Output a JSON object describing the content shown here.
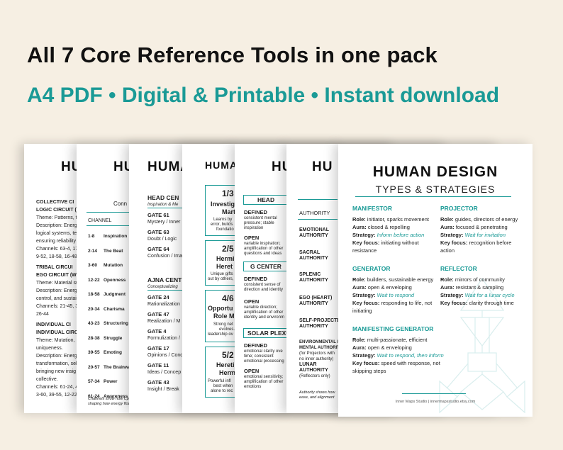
{
  "headline": "All 7 Core Reference Tools in one pack",
  "subline": "A4 PDF • Digital & Printable • Instant download",
  "colors": {
    "background": "#f6efe3",
    "teal": "#1a9a96",
    "text": "#111111"
  },
  "page1": {
    "title": "HU",
    "l1": "COLLECTIVE CI",
    "l2": "LOGIC CIRCUIT (L",
    "l3": "Theme: Patterns, t",
    "l4": "Description: Energ",
    "l5": "logical systems, te",
    "l6": "ensuring reliability",
    "l7": "Channels: 63-4, 17",
    "l8": "9-52, 18-58, 16-48",
    "l9": "TRIBAL CIRCUI",
    "l10": "EGO CIRCUIT (WI",
    "l11": "Theme: Material su",
    "l12": "Description: Energ",
    "l13": "control, and sustai",
    "l14": "Channels: 21-45, 3",
    "l15": "26-44",
    "l16": "INDIVIDUAL CI",
    "l17": "INDIVIDUAL CIRC",
    "l18": "Theme: Mutation,",
    "l19": "uniqueness.",
    "l20": "Description: Energ",
    "l21": "transformation, sel",
    "l22": "bringing new insig",
    "l23": "collective.",
    "l24": "Channels: 61-24, 4",
    "l25": "3-60, 39-55, 12-22,"
  },
  "page2": {
    "title": "HU",
    "conn": "Conn",
    "col": "CHANNEL",
    "rows": [
      {
        "num": "1-8",
        "name": "Inspiration"
      },
      {
        "num": "2-14",
        "name": "The Beat"
      },
      {
        "num": "3-60",
        "name": "Mutation"
      },
      {
        "num": "12-22",
        "name": "Openness"
      },
      {
        "num": "18-58",
        "name": "Judgment"
      },
      {
        "num": "20-34",
        "name": "Charisma"
      },
      {
        "num": "43-23",
        "name": "Structuring"
      },
      {
        "num": "28-38",
        "name": "Struggle"
      },
      {
        "num": "39-55",
        "name": "Emoting"
      },
      {
        "num": "20-57",
        "name": "The Brainwa"
      },
      {
        "num": "57-34",
        "name": "Power"
      },
      {
        "num": "61-24",
        "name": "Awareness"
      }
    ],
    "foot1": "Channels show how Cp",
    "foot2": "shaping how energy flow"
  },
  "page3": {
    "title": "HUMAN",
    "head": "HEAD CEN",
    "head_sub": "Inspiration & Me",
    "g61": "GATE 61",
    "g61d": "Mystery / Inner",
    "g63": "GATE 63",
    "g63d": "Doubt / Logic",
    "g64": "GATE 64",
    "g64d": "Confusion / Ima",
    "ajna": "AJNA CENT",
    "ajna_sub": "Conceptualizing",
    "g24": "GATE 24",
    "g24d": "Rationalization",
    "g47": "GATE 47",
    "g47d": "Realization / M",
    "g4": "GATE 4",
    "g4d": "Formulization /",
    "g17": "GATE 17",
    "g17d": "Opinions / Cond",
    "g11": "GATE 11",
    "g11d": "Ideas / Concep",
    "g43": "GATE 43",
    "g43d": "Insight / Break"
  },
  "page4": {
    "title": "HUMA",
    "c1a": "1/3",
    "c1b": "Investig",
    "c1c": "Mart",
    "c1d": "Learns by",
    "c1e": "error, builds",
    "c1f": "foundatio",
    "c2a": "2/5",
    "c2b": "Hermi",
    "c2c": "Heret",
    "c2d": "Unique gifts",
    "c2e": "out by others,",
    "c2f": "problem-s",
    "c3a": "4/6",
    "c3b": "Opportu",
    "c3c": "Role M",
    "c3d": "Strong net",
    "c3e": "evolves.",
    "c3f": "leadership ov",
    "c4a": "5/2",
    "c4b": "Hereti",
    "c4c": "Herm",
    "c4d": "Powerful infl",
    "c4e": "best when",
    "c4f": "alone to rec"
  },
  "page5": {
    "title": "HU",
    "head": "HEAD",
    "def": "DEFINED",
    "d1": "consistent mental",
    "d2": "pressure; stable",
    "d3": "inspiration",
    "open": "OPEN",
    "o1": "variable inspiration;",
    "o2": "amplification of other",
    "o3": "questions and ideas",
    "g": "G CENTER",
    "gdef": "DEFINED",
    "gd1": "consistent sense of",
    "gd2": "direction and identity",
    "gopen": "OPEN",
    "go1": "variable direction;",
    "go2": "amplification of other",
    "go3": "identity and environm",
    "sp": "SOLAR PLEXU",
    "sdef": "DEFINED",
    "sd1": "emotional clarity ove",
    "sd2": "time; consistent",
    "sd3": "emotional processing",
    "sopen": "OPEN",
    "so1": "emotional sensitivity;",
    "so2": "amplification of other",
    "so3": "emotions"
  },
  "page6": {
    "title": "HU",
    "col": "AUTHORITY",
    "a1": "EMOTIONAL",
    "a1b": "AUTHORITY",
    "a2": "SACRAL",
    "a2b": "AUTHORITY",
    "a3": "SPLENIC",
    "a3b": "AUTHORITY",
    "a4": "EGO (HEART)",
    "a4b": "AUTHORITY",
    "a5": "SELF-PROJECTE",
    "a5b": "AUTHORITY",
    "a6": "ENVIRONMENTAL /",
    "a6b": "MENTAL AUTHORIT",
    "a6c": "(for Projectors with",
    "a6d": "no inner authority)",
    "a7": "LUNAR",
    "a7b": "AUTHORITY",
    "a7c": "(Reflectors only)",
    "foot1": "Authority shows how",
    "foot2": "ease, and alignment"
  },
  "front": {
    "title": "HUMAN DESIGN",
    "subtitle": "TYPES & STRATEGIES",
    "manifestor": {
      "h": "MANIFESTOR",
      "role_k": "Role:",
      "role": "initiator, sparks movement",
      "aura_k": "Aura:",
      "aura": "closed & repelling",
      "strat_k": "Strategy:",
      "strat": "Inform before action",
      "key_k": "Key focus:",
      "key1": "initiating without",
      "key2": "resistance"
    },
    "projector": {
      "h": "PROJECTOR",
      "role_k": "Role:",
      "role": "guides, directors of energy",
      "aura_k": "Aura:",
      "aura": "focused & penetrating",
      "strat_k": "Strategy:",
      "strat": "Wait for invitation",
      "key_k": "Key focus:",
      "key1": "recognition before",
      "key2": "action"
    },
    "generator": {
      "h": "GENERATOR",
      "role_k": "Role:",
      "role": "builders, sustainable energy",
      "aura_k": "Aura:",
      "aura": "open & enveloping",
      "strat_k": "Strategy:",
      "strat": "Wait to respond",
      "key_k": "Key focus:",
      "key1": "responding to life, not",
      "key2": "initiating"
    },
    "reflector": {
      "h": "REFLECTOR",
      "role_k": "Role:",
      "role": "mirrors of community",
      "aura_k": "Aura:",
      "aura": "resistant & sampling",
      "strat_k": "Strategy:",
      "strat": "Wait for a lunar cycle",
      "key_k": "Key focus:",
      "key1": "clarity through time"
    },
    "mg": {
      "h": "MANIFESTING GENERATOR",
      "role_k": "Role:",
      "role": "multi-passionate, efficient",
      "aura_k": "Aura:",
      "aura": "open & enveloping",
      "strat_k": "Strategy:",
      "strat": "Wait to respond, then inform",
      "key_k": "Key focus:",
      "key1": " speed with response, not",
      "key2": "skipping steps"
    },
    "footer": "Inner Maps Studio | innermapsstudio.etsy.com"
  }
}
